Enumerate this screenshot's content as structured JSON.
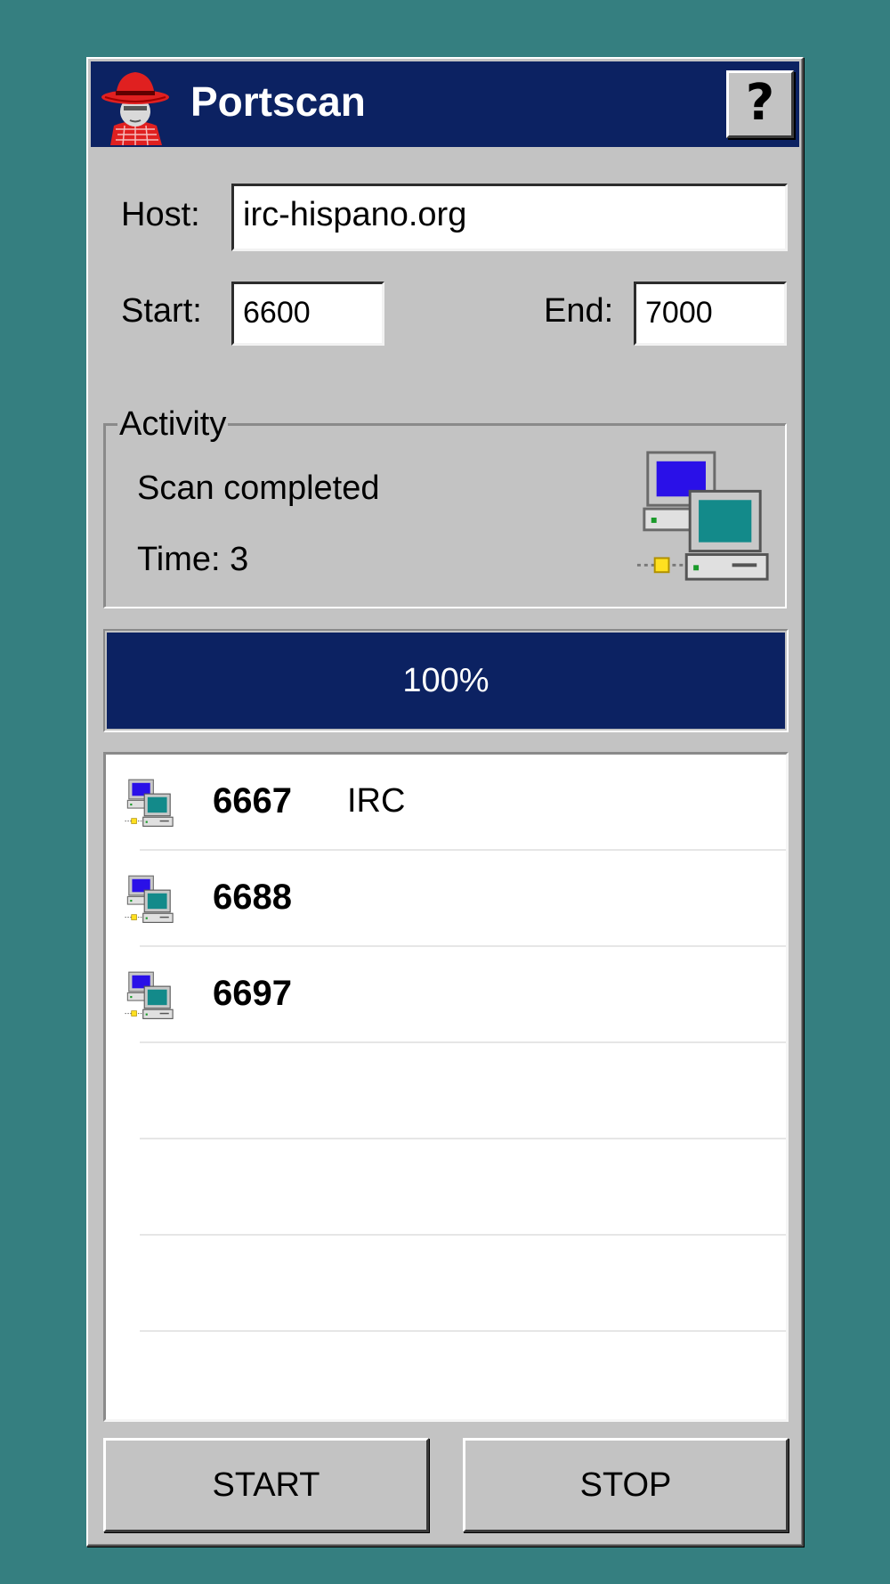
{
  "window": {
    "title": "Portscan",
    "help_label": "?",
    "colors": {
      "titlebar": "#0c2262",
      "face": "#c3c3c3",
      "desktop": "#357f80"
    }
  },
  "form": {
    "host_label": "Host:",
    "host_value": "irc-hispano.org",
    "start_label": "Start:",
    "start_value": "6600",
    "end_label": "End:",
    "end_value": "7000"
  },
  "activity": {
    "legend": "Activity",
    "status": "Scan completed",
    "time": "Time: 3",
    "icon": "network-computers-icon"
  },
  "progress": {
    "fraction": 1.0,
    "label": "100%"
  },
  "results": [
    {
      "port": "6667",
      "service": "IRC",
      "icon": "network-computers-icon"
    },
    {
      "port": "6688",
      "service": "",
      "icon": "network-computers-icon"
    },
    {
      "port": "6697",
      "service": "",
      "icon": "network-computers-icon"
    }
  ],
  "buttons": {
    "start_label": "START",
    "stop_label": "STOP"
  }
}
